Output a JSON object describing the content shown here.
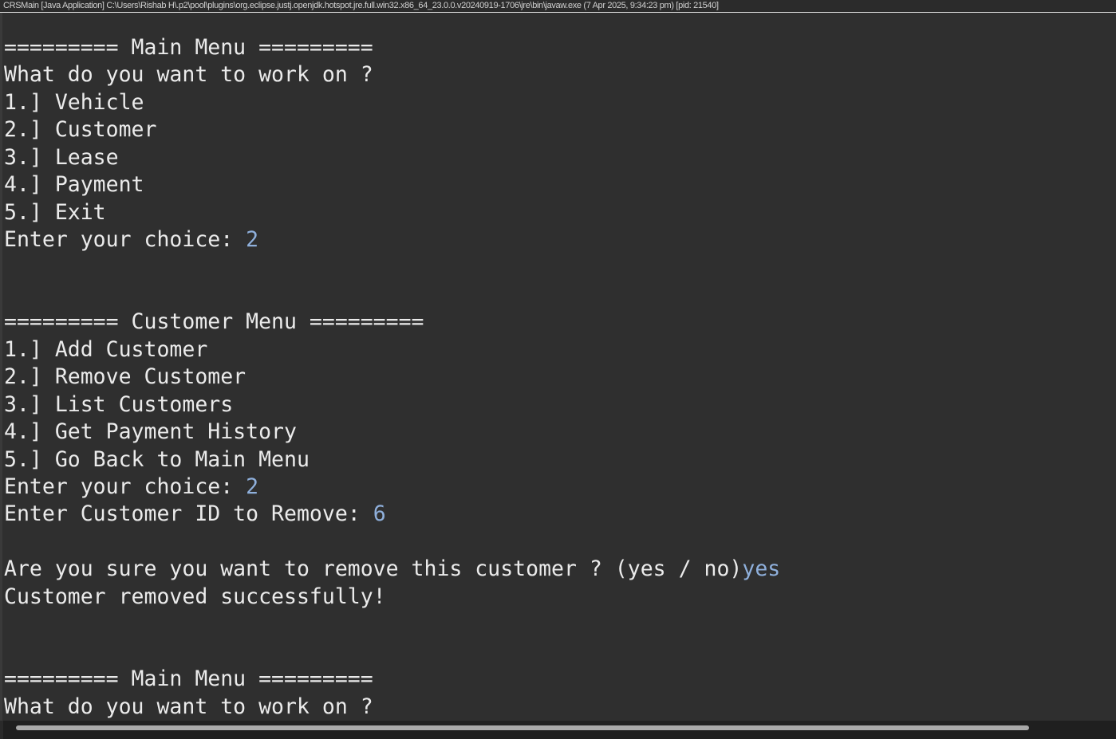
{
  "window": {
    "title": "CRSMain [Java Application] C:\\Users\\Rishab H\\.p2\\pool\\plugins\\org.eclipse.justj.openjdk.hotspot.jre.full.win32.x86_64_23.0.0.v20240919-1706\\jre\\bin\\javaw.exe  (7 Apr 2025, 9:34:23 pm) [pid: 21540]"
  },
  "colors": {
    "background": "#2f2f2f",
    "output_text": "#ebebeb",
    "user_input": "#8fb0dc"
  },
  "console": {
    "lines": [
      {
        "text": "========= Main Menu =========",
        "input": ""
      },
      {
        "text": "What do you want to work on ?",
        "input": ""
      },
      {
        "text": "1.] Vehicle",
        "input": ""
      },
      {
        "text": "2.] Customer",
        "input": ""
      },
      {
        "text": "3.] Lease",
        "input": ""
      },
      {
        "text": "4.] Payment",
        "input": ""
      },
      {
        "text": "5.] Exit",
        "input": ""
      },
      {
        "text": "Enter your choice: ",
        "input": "2"
      },
      {
        "text": "",
        "input": ""
      },
      {
        "text": "",
        "input": ""
      },
      {
        "text": "========= Customer Menu =========",
        "input": ""
      },
      {
        "text": "1.] Add Customer",
        "input": ""
      },
      {
        "text": "2.] Remove Customer",
        "input": ""
      },
      {
        "text": "3.] List Customers",
        "input": ""
      },
      {
        "text": "4.] Get Payment History",
        "input": ""
      },
      {
        "text": "5.] Go Back to Main Menu",
        "input": ""
      },
      {
        "text": "Enter your choice: ",
        "input": "2"
      },
      {
        "text": "Enter Customer ID to Remove: ",
        "input": "6"
      },
      {
        "text": "",
        "input": ""
      },
      {
        "text": "Are you sure you want to remove this customer ? (yes / no)",
        "input": "yes"
      },
      {
        "text": "Customer removed successfully!",
        "input": ""
      },
      {
        "text": "",
        "input": ""
      },
      {
        "text": "",
        "input": ""
      },
      {
        "text": "========= Main Menu =========",
        "input": ""
      },
      {
        "text": "What do you want to work on ?",
        "input": ""
      }
    ]
  }
}
